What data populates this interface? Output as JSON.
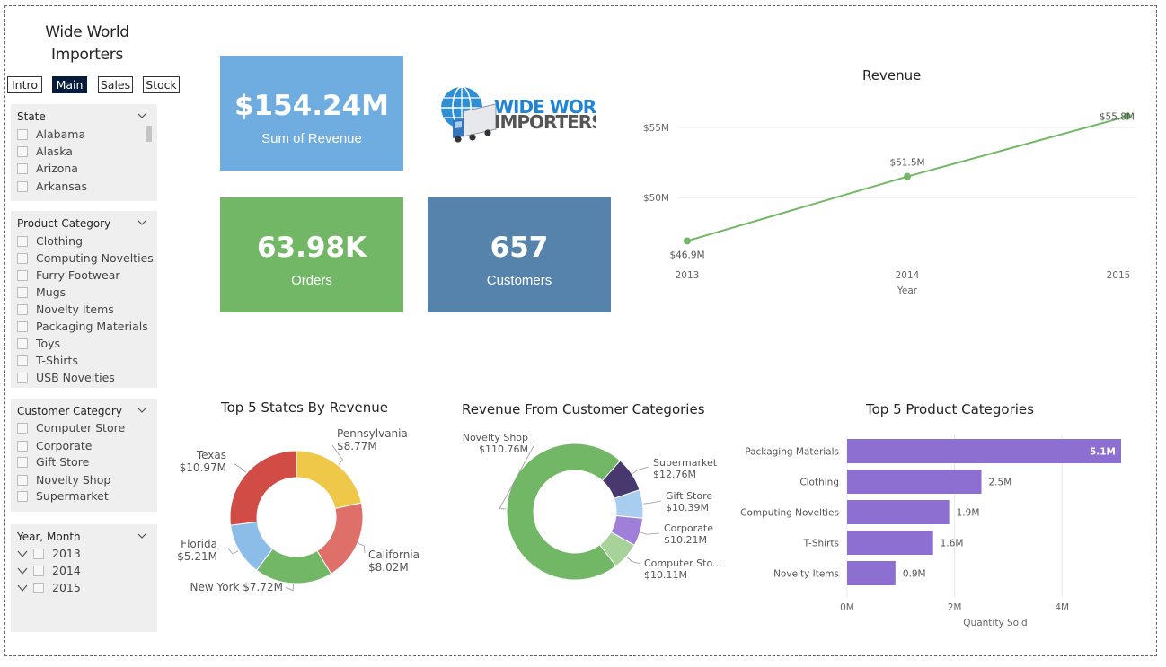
{
  "app": {
    "title_line1": "Wide World",
    "title_line2": "Importers"
  },
  "nav": {
    "items": [
      "Intro",
      "Main",
      "Sales",
      "Stock"
    ],
    "active": "Main"
  },
  "slicers": {
    "state": {
      "title": "State",
      "items": [
        "Alabama",
        "Alaska",
        "Arizona",
        "Arkansas"
      ]
    },
    "product_category": {
      "title": "Product Category",
      "items": [
        "Clothing",
        "Computing Novelties",
        "Furry Footwear",
        "Mugs",
        "Novelty Items",
        "Packaging Materials",
        "Toys",
        "T-Shirts",
        "USB Novelties"
      ]
    },
    "customer_category": {
      "title": "Customer Category",
      "items": [
        "Computer Store",
        "Corporate",
        "Gift Store",
        "Novelty Shop",
        "Supermarket"
      ]
    },
    "year_month": {
      "title": "Year, Month",
      "items": [
        "2013",
        "2014",
        "2015"
      ]
    }
  },
  "cards": {
    "revenue": {
      "value": "$154.24M",
      "label": "Sum of Revenue",
      "color": "#6fade1"
    },
    "orders": {
      "value": "63.98K",
      "label": "Orders",
      "color": "#72b765"
    },
    "customers": {
      "value": "657",
      "label": "Customers",
      "color": "#5683ab"
    }
  },
  "logo": {
    "line1": "WIDE WORLD",
    "line2": "IMPORTERS"
  },
  "chart_data": [
    {
      "type": "line",
      "title": "Revenue",
      "xlabel": "Year",
      "ylabel": "",
      "x": [
        "2013",
        "2014",
        "2015"
      ],
      "values": [
        46.9,
        51.5,
        55.8
      ],
      "data_labels": [
        "$46.9M",
        "$51.5M",
        "$55.8M"
      ],
      "yticks": [
        {
          "value": 50,
          "label": "$50M"
        },
        {
          "value": 55,
          "label": "$55M"
        }
      ],
      "ylim": [
        45.2,
        57.5
      ],
      "grid": true,
      "color": "#72b765"
    },
    {
      "type": "pie",
      "title": "Top 5 States By Revenue",
      "categories": [
        "Pennsylvania",
        "California",
        "New York",
        "Florida",
        "Texas"
      ],
      "values": [
        8.77,
        8.02,
        7.72,
        5.21,
        10.97
      ],
      "labels": [
        "$8.77M",
        "$8.02M",
        "$7.72M",
        "$5.21M",
        "$10.97M"
      ],
      "colors": [
        "#efc84a",
        "#de6f69",
        "#72b765",
        "#8bbde8",
        "#d24c46"
      ]
    },
    {
      "type": "pie",
      "title": "Revenue From Customer Categories",
      "categories": [
        "Novelty Shop",
        "Supermarket",
        "Gift Store",
        "Corporate",
        "Computer Sto..."
      ],
      "values": [
        110.76,
        12.76,
        10.39,
        10.21,
        10.11
      ],
      "labels": [
        "$110.76M",
        "$12.76M",
        "$10.39M",
        "$10.21M",
        "$10.11M"
      ],
      "colors": [
        "#72b765",
        "#47386e",
        "#a8cdee",
        "#a07fd8",
        "#a7d39a"
      ]
    },
    {
      "type": "bar",
      "title": "Top 5 Product Categories",
      "categories": [
        "Packaging Materials",
        "Clothing",
        "Computing Novelties",
        "T-Shirts",
        "Novelty Items"
      ],
      "values": [
        5.1,
        2.5,
        1.9,
        1.6,
        0.9
      ],
      "labels": [
        "5.1M",
        "2.5M",
        "1.9M",
        "1.6M",
        "0.9M"
      ],
      "xlabel": "Quantity Sold",
      "xticks": [
        "0M",
        "2M",
        "4M"
      ],
      "xlim": [
        0,
        5.1
      ],
      "color": "#8d6fd1"
    }
  ]
}
